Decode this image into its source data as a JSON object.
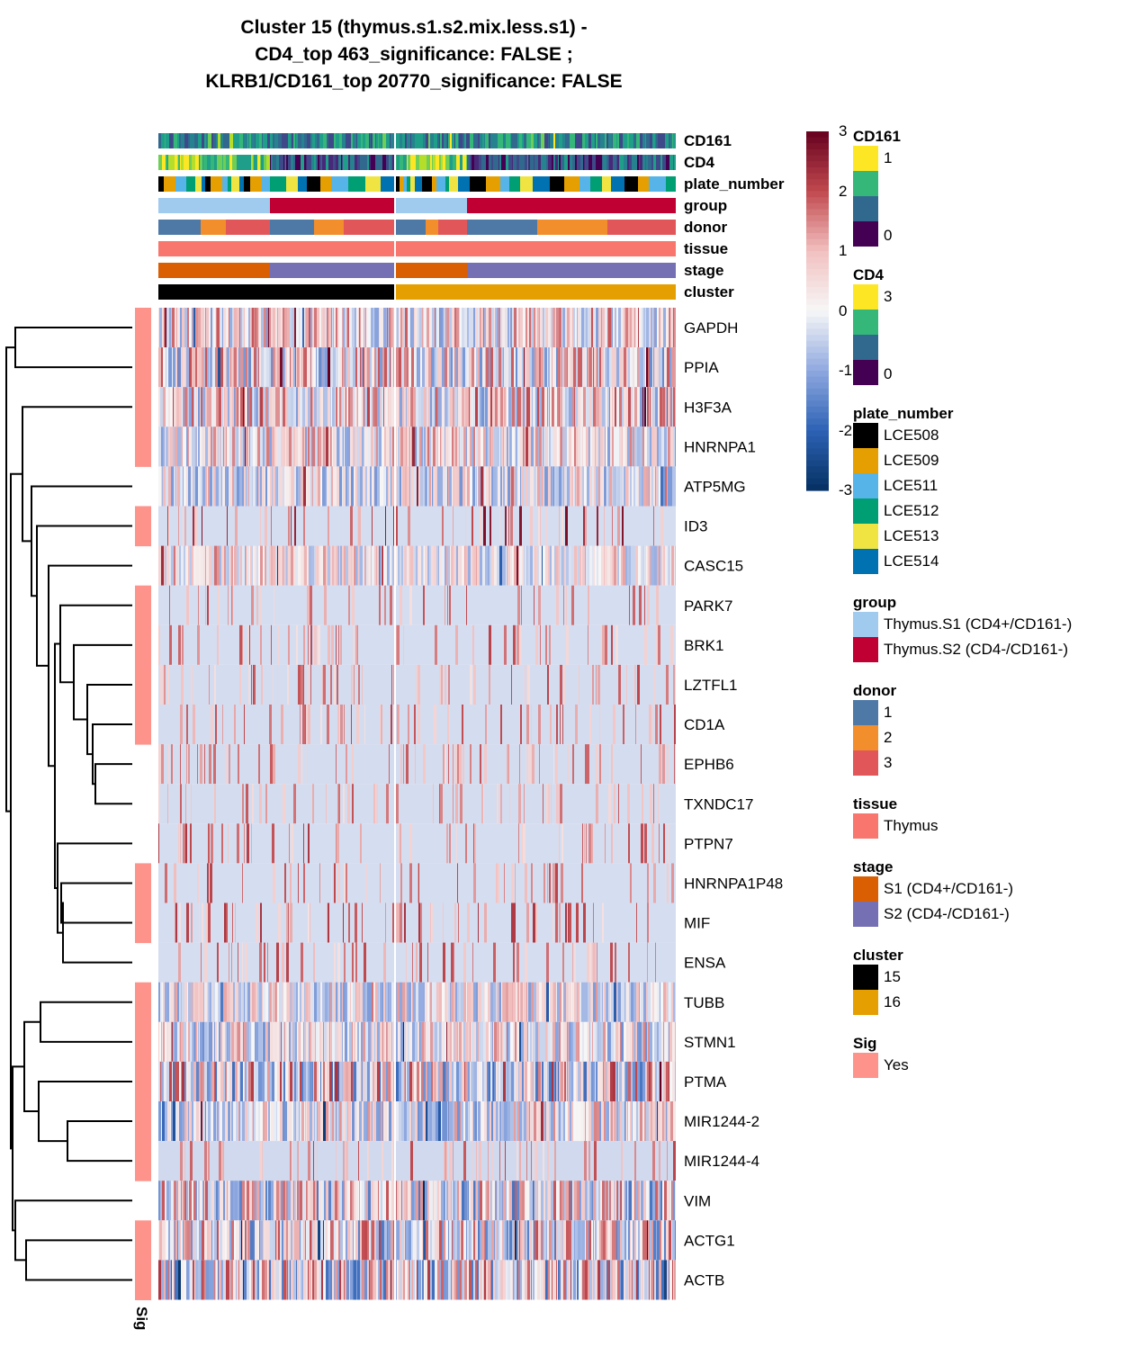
{
  "title": {
    "lines": [
      "Cluster 15 (thymus.s1.s2.mix.less.s1) -",
      "CD4_top 463_significance: FALSE ;",
      "KLRB1/CD161_top 20770_significance: FALSE"
    ]
  },
  "chart_data": {
    "type": "heatmap",
    "title": "Cluster 15 (thymus.s1.s2.mix.less.s1) - CD4_top 463_significance: FALSE ; KLRB1/CD161_top 20770_significance: FALSE",
    "rows": [
      "GAPDH",
      "PPIA",
      "H3F3A",
      "HNRNPA1",
      "ATP5MG",
      "ID3",
      "CASC15",
      "PARK7",
      "BRK1",
      "LZTFL1",
      "CD1A",
      "EPHB6",
      "TXNDC17",
      "PTPN7",
      "HNRNPA1P48",
      "MIF",
      "ENSA",
      "TUBB",
      "STMN1",
      "PTMA",
      "MIR1244-2",
      "MIR1244-4",
      "VIM",
      "ACTG1",
      "ACTB"
    ],
    "row_sig": [
      true,
      true,
      true,
      true,
      false,
      true,
      false,
      true,
      true,
      true,
      true,
      false,
      false,
      false,
      true,
      true,
      false,
      true,
      true,
      true,
      true,
      true,
      false,
      true,
      true
    ],
    "row_mean_level": [
      0.2,
      0.1,
      0.25,
      0.15,
      -0.15,
      -0.05,
      0.1,
      -0.05,
      -0.05,
      -0.08,
      -0.08,
      -0.08,
      -0.08,
      -0.05,
      -0.05,
      -0.05,
      -0.05,
      -0.05,
      -0.05,
      0.0,
      -0.1,
      -0.15,
      -0.1,
      0.0,
      0.0
    ],
    "column_splits": [
      {
        "cluster": "15",
        "segments": [
          {
            "group": "Thymus.S1 (CD4+/CD161-)",
            "stage": "S1 (CD4+/CD161-)",
            "fraction": 0.47
          },
          {
            "group": "Thymus.S2 (CD4-/CD161-)",
            "stage": "S2 (CD4-/CD161-)",
            "fraction": 0.53
          }
        ]
      },
      {
        "cluster": "16",
        "segments": [
          {
            "group": "Thymus.S1 (CD4+/CD161-)",
            "stage": "S1 (CD4+/CD161-)",
            "fraction": 0.25
          },
          {
            "group": "Thymus.S2 (CD4-/CD161-)",
            "stage": "S2 (CD4-/CD161-)",
            "fraction": 0.75
          }
        ]
      }
    ],
    "column_split_fraction": 0.456,
    "annotations": [
      "CD161",
      "CD4",
      "plate_number",
      "group",
      "donor",
      "tissue",
      "stage",
      "cluster"
    ],
    "donor_segments": [
      {
        "cluster": "15",
        "group": "S1",
        "donors": [
          {
            "donor": "1",
            "fraction": 0.38
          },
          {
            "donor": "2",
            "fraction": 0.23
          },
          {
            "donor": "3",
            "fraction": 0.39
          }
        ]
      },
      {
        "cluster": "15",
        "group": "S2",
        "donors": [
          {
            "donor": "1",
            "fraction": 0.36
          },
          {
            "donor": "2",
            "fraction": 0.24
          },
          {
            "donor": "3",
            "fraction": 0.4
          }
        ]
      },
      {
        "cluster": "16",
        "group": "S1",
        "donors": [
          {
            "donor": "1",
            "fraction": 0.42
          },
          {
            "donor": "2",
            "fraction": 0.18
          },
          {
            "donor": "3",
            "fraction": 0.4
          }
        ]
      },
      {
        "cluster": "16",
        "group": "S2",
        "donors": [
          {
            "donor": "1",
            "fraction": 0.34
          },
          {
            "donor": "2",
            "fraction": 0.34
          },
          {
            "donor": "3",
            "fraction": 0.32
          }
        ]
      }
    ],
    "color_scale": {
      "min": -3,
      "max": 3,
      "ticks": [
        "3",
        "2",
        "1",
        "0",
        "-1",
        "-2",
        "-3"
      ],
      "low": "#053061",
      "mid": "#f7f7f7",
      "high": "#67001f"
    },
    "legend_placement": "right",
    "dendrogram": "rows-left",
    "row_annotation_label": "Sig"
  },
  "legends": [
    {
      "title": "CD161",
      "type": "continuous",
      "items": [
        {
          "label": "1",
          "color": "#fde725"
        },
        {
          "label": "",
          "color": "#35b779"
        },
        {
          "label": "",
          "color": "#31688e"
        },
        {
          "label": "0",
          "color": "#440154"
        }
      ]
    },
    {
      "title": "CD4",
      "type": "continuous",
      "items": [
        {
          "label": "3",
          "color": "#fde725"
        },
        {
          "label": "",
          "color": "#35b779"
        },
        {
          "label": "",
          "color": "#31688e"
        },
        {
          "label": "0",
          "color": "#440154"
        }
      ]
    },
    {
      "title": "plate_number",
      "items": [
        {
          "label": "LCE508",
          "color": "#000000"
        },
        {
          "label": "LCE509",
          "color": "#e69f00"
        },
        {
          "label": "LCE511",
          "color": "#56b4e9"
        },
        {
          "label": "LCE512",
          "color": "#009e73"
        },
        {
          "label": "LCE513",
          "color": "#f0e442"
        },
        {
          "label": "LCE514",
          "color": "#0072b2"
        }
      ]
    },
    {
      "title": "group",
      "items": [
        {
          "label": "Thymus.S1 (CD4+/CD161-)",
          "color": "#a0cbef"
        },
        {
          "label": "Thymus.S2 (CD4-/CD161-)",
          "color": "#c00033"
        }
      ]
    },
    {
      "title": "donor",
      "items": [
        {
          "label": "1",
          "color": "#4e79a7"
        },
        {
          "label": "2",
          "color": "#f28e2b"
        },
        {
          "label": "3",
          "color": "#e15759"
        }
      ]
    },
    {
      "title": "tissue",
      "items": [
        {
          "label": "Thymus",
          "color": "#f8766d"
        }
      ]
    },
    {
      "title": "stage",
      "items": [
        {
          "label": "S1 (CD4+/CD161-)",
          "color": "#d95f02"
        },
        {
          "label": "S2 (CD4-/CD161-)",
          "color": "#7570b3"
        }
      ]
    },
    {
      "title": "cluster",
      "items": [
        {
          "label": "15",
          "color": "#000000"
        },
        {
          "label": "16",
          "color": "#e69f00"
        }
      ]
    },
    {
      "title": "Sig",
      "items": [
        {
          "label": "Yes",
          "color": "#fe938c"
        }
      ]
    }
  ]
}
